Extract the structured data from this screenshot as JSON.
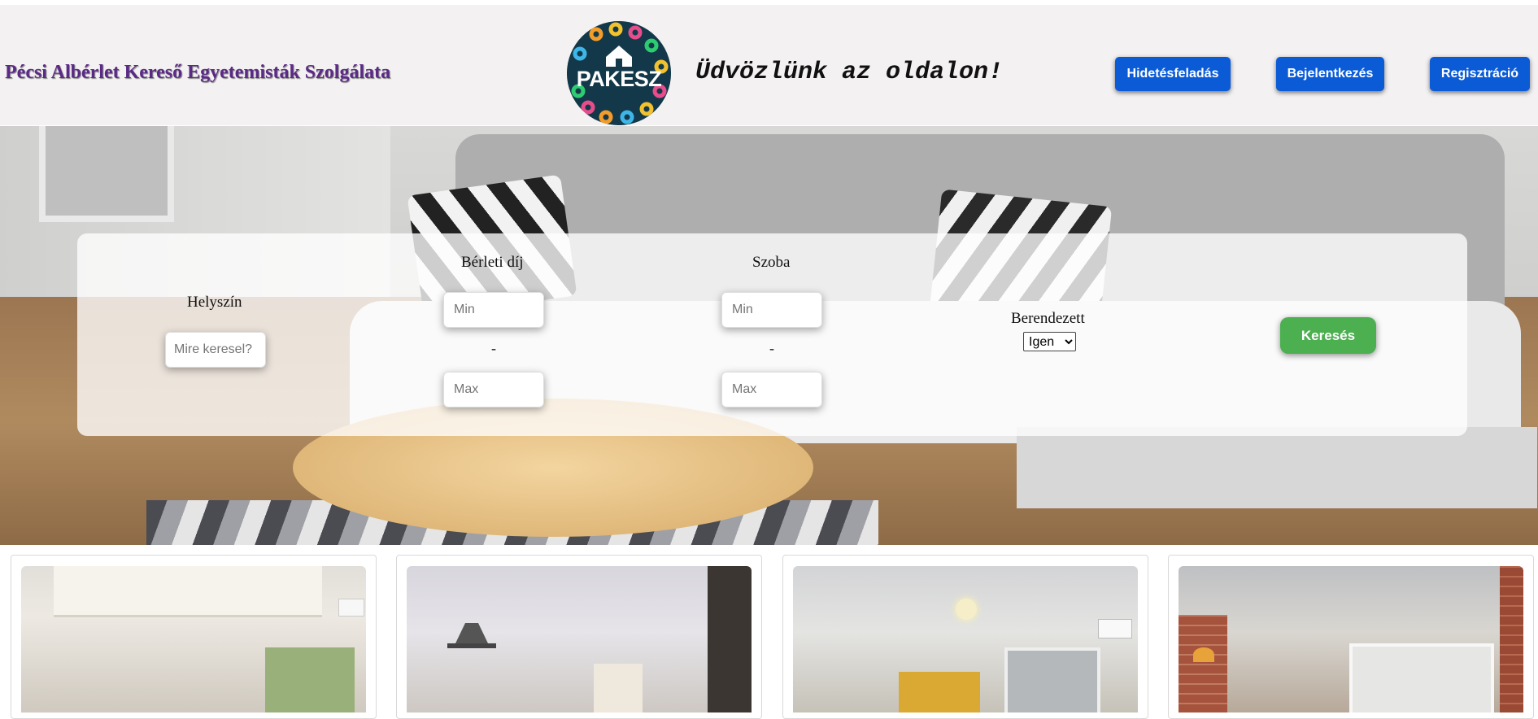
{
  "header": {
    "site_title": "Pécsi Albérlet Kereső Egyetemisták Szolgálata",
    "logo_text": "PAKESZ",
    "welcome": "Üdvözlünk az oldalon!",
    "nav": {
      "post_ad": "Hidetésfeladás",
      "login": "Bejelentkezés",
      "register": "Regisztráció"
    },
    "colors": {
      "nav_button": "#0b5bd7",
      "title": "#5b2a86",
      "background": "#f3f1f2"
    }
  },
  "search": {
    "location_label": "Helyszín",
    "location_placeholder": "Mire keresel?",
    "rent_label": "Bérleti díj",
    "rent_min_placeholder": "Min",
    "rent_max_placeholder": "Max",
    "rooms_label": "Szoba",
    "rooms_min_placeholder": "Min",
    "rooms_max_placeholder": "Max",
    "separator": "-",
    "furnished_label": "Berendezett",
    "furnished_selected": "Igen",
    "submit": "Keresés",
    "colors": {
      "submit_button": "#4caf50"
    }
  },
  "listings": [
    {
      "image": "bright-living-room-photo"
    },
    {
      "image": "open-kitchen-living-room-photo"
    },
    {
      "image": "kitchen-with-yellow-cabinets-photo"
    },
    {
      "image": "brick-wall-living-room-photo"
    }
  ]
}
